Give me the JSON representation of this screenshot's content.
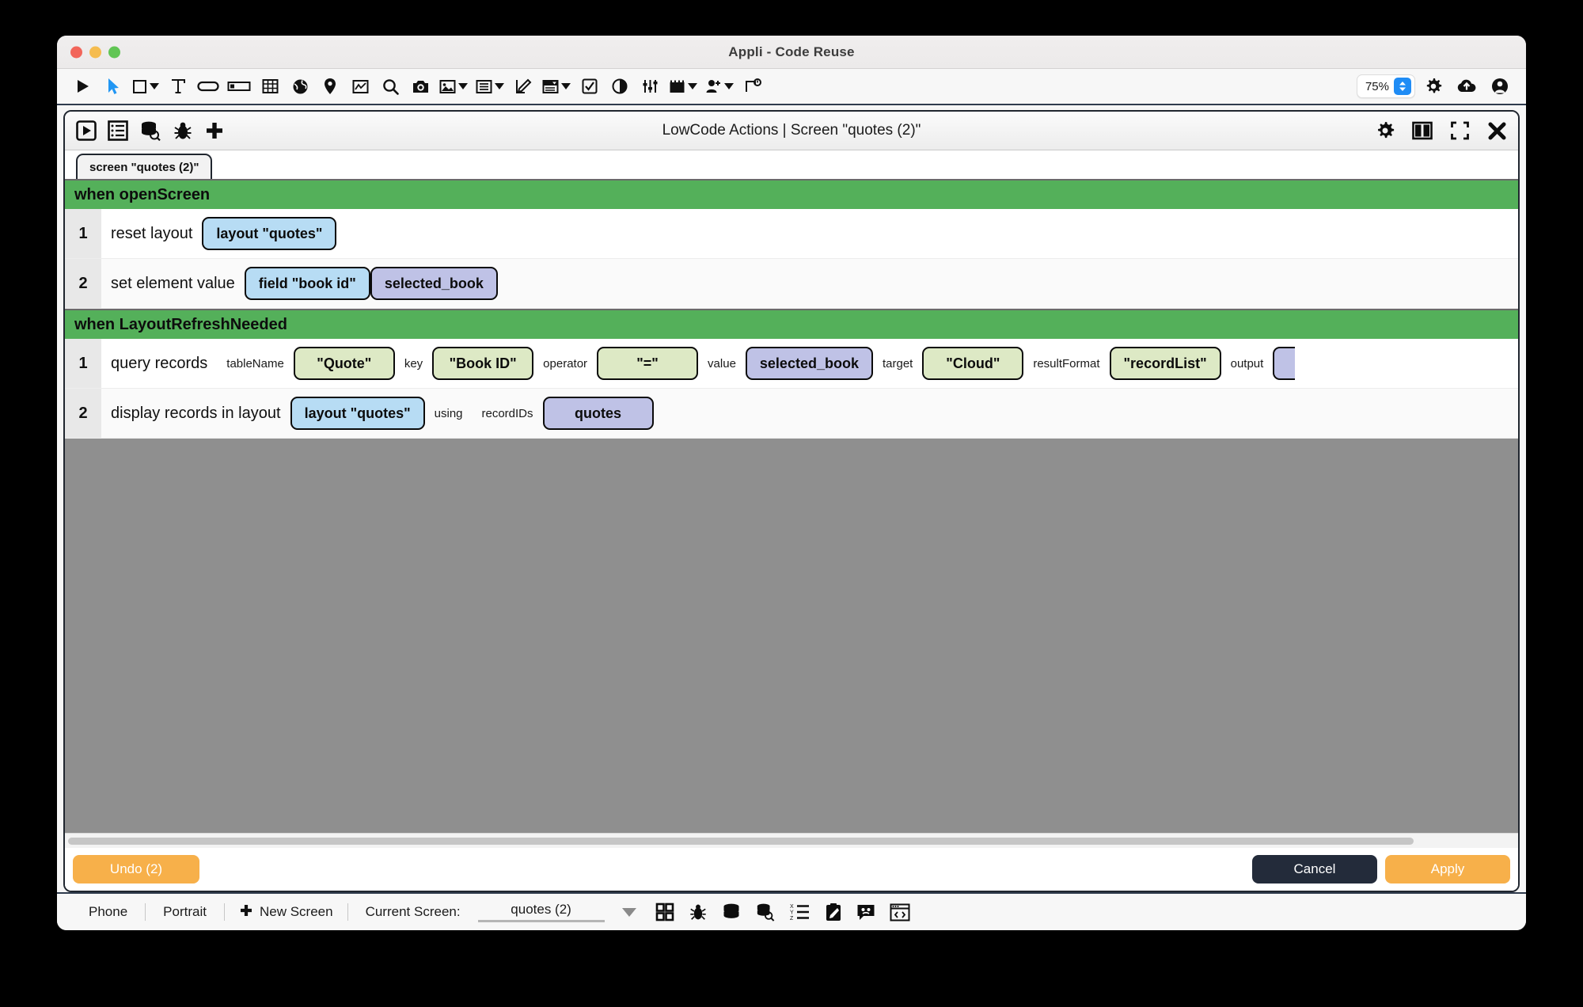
{
  "window": {
    "title": "Appli - Code Reuse",
    "traffic_lights": [
      "close",
      "minimize",
      "zoom"
    ]
  },
  "app_toolbar": {
    "left_icons": [
      {
        "name": "play-icon",
        "glyph": "play"
      },
      {
        "name": "cursor-select-icon",
        "glyph": "cursor"
      },
      {
        "name": "rectangle-shape-icon",
        "glyph": "square",
        "dropdown": true
      },
      {
        "name": "text-tool-icon",
        "glyph": "T"
      },
      {
        "name": "button-icon",
        "glyph": "pill"
      },
      {
        "name": "text-field-icon",
        "glyph": "field"
      },
      {
        "name": "table-icon",
        "glyph": "grid"
      },
      {
        "name": "web-view-icon",
        "glyph": "globe"
      },
      {
        "name": "map-pin-icon",
        "glyph": "pin"
      },
      {
        "name": "chart-icon",
        "glyph": "chart"
      },
      {
        "name": "search-icon",
        "glyph": "magnifier"
      },
      {
        "name": "camera-icon",
        "glyph": "camera"
      },
      {
        "name": "image-icon",
        "glyph": "image",
        "dropdown": true
      },
      {
        "name": "list-icon",
        "glyph": "list",
        "dropdown": true
      },
      {
        "name": "signature-icon",
        "glyph": "edit-square"
      },
      {
        "name": "dropdown-control-icon",
        "glyph": "select",
        "dropdown": true
      },
      {
        "name": "checkbox-icon",
        "glyph": "checkbox"
      },
      {
        "name": "toggle-icon",
        "glyph": "toggle"
      },
      {
        "name": "slider-icon",
        "glyph": "sliders"
      },
      {
        "name": "date-picker-icon",
        "glyph": "calendar",
        "dropdown": true
      },
      {
        "name": "add-user-icon",
        "glyph": "person-plus",
        "dropdown": true
      },
      {
        "name": "push-notification-icon",
        "glyph": "flag"
      }
    ],
    "zoom_value": "75%",
    "right_icons": [
      {
        "name": "settings-gear-icon",
        "glyph": "gear"
      },
      {
        "name": "cloud-upload-icon",
        "glyph": "cloud-up"
      },
      {
        "name": "account-icon",
        "glyph": "person"
      }
    ]
  },
  "lowcode_panel": {
    "title": "LowCode Actions | Screen \"quotes (2)\"",
    "left_icons": [
      {
        "name": "run-actions-icon",
        "glyph": "play-box"
      },
      {
        "name": "actions-list-icon",
        "glyph": "list-box"
      },
      {
        "name": "data-query-icon",
        "glyph": "db-search"
      },
      {
        "name": "debug-icon",
        "glyph": "bug"
      },
      {
        "name": "add-action-icon",
        "glyph": "plus"
      }
    ],
    "right_icons": [
      {
        "name": "panel-settings-icon",
        "glyph": "gear"
      },
      {
        "name": "split-view-icon",
        "glyph": "split"
      },
      {
        "name": "fullscreen-icon",
        "glyph": "expand"
      },
      {
        "name": "close-panel-icon",
        "glyph": "x"
      }
    ],
    "tab_label": "screen \"quotes (2)\"",
    "blocks": [
      {
        "event": "when openScreen",
        "rows": [
          {
            "number": "1",
            "verb": "reset layout",
            "parts": [
              {
                "kind": "chip",
                "style": "blue",
                "text": "layout \"quotes\"",
                "name": "chip-layout-quotes"
              }
            ]
          },
          {
            "number": "2",
            "verb": "set element value",
            "parts": [
              {
                "kind": "chip",
                "style": "blue",
                "text": "field \"book id\"",
                "name": "chip-field-book-id"
              },
              {
                "kind": "chip",
                "style": "purple",
                "text": "selected_book",
                "name": "chip-selected-book"
              }
            ]
          }
        ]
      },
      {
        "event": "when LayoutRefreshNeeded",
        "rows": [
          {
            "number": "1",
            "verb": "query records",
            "parts": [
              {
                "kind": "label",
                "text": "tableName",
                "name": "param-label-tablename"
              },
              {
                "kind": "chip",
                "style": "green",
                "text": "\"Quote\"",
                "name": "chip-table-quote"
              },
              {
                "kind": "label",
                "text": "key",
                "name": "param-label-key"
              },
              {
                "kind": "chip",
                "style": "green",
                "text": "\"Book ID\"",
                "name": "chip-key-book-id"
              },
              {
                "kind": "label",
                "text": "operator",
                "name": "param-label-operator"
              },
              {
                "kind": "chip",
                "style": "green",
                "text": "\"=\"",
                "name": "chip-operator-equals"
              },
              {
                "kind": "label",
                "text": "value",
                "name": "param-label-value"
              },
              {
                "kind": "chip",
                "style": "purple",
                "text": "selected_book",
                "name": "chip-value-selected-book"
              },
              {
                "kind": "label",
                "text": "target",
                "name": "param-label-target"
              },
              {
                "kind": "chip",
                "style": "green",
                "text": "\"Cloud\"",
                "name": "chip-target-cloud"
              },
              {
                "kind": "label",
                "text": "resultFormat",
                "name": "param-label-resultformat"
              },
              {
                "kind": "chip",
                "style": "green",
                "text": "\"recordList\"",
                "name": "chip-resultformat-recordlist"
              },
              {
                "kind": "label",
                "text": "output",
                "name": "param-label-output"
              },
              {
                "kind": "chip-clipped",
                "style": "purple",
                "text": "",
                "name": "chip-output-clipped"
              }
            ]
          },
          {
            "number": "2",
            "verb": "display records in layout",
            "parts": [
              {
                "kind": "chip",
                "style": "blue",
                "text": "layout \"quotes\"",
                "name": "chip-display-layout-quotes"
              },
              {
                "kind": "label",
                "text": "using",
                "name": "param-label-using"
              },
              {
                "kind": "label",
                "text": "recordIDs",
                "name": "param-label-recordids"
              },
              {
                "kind": "chip",
                "style": "purple",
                "text": "quotes",
                "name": "chip-recordids-quotes"
              }
            ]
          }
        ]
      }
    ]
  },
  "action_bar": {
    "undo_label": "Undo (2)",
    "cancel_label": "Cancel",
    "apply_label": "Apply"
  },
  "status_bar": {
    "device": "Phone",
    "orientation": "Portrait",
    "new_screen_label": "New Screen",
    "current_screen_label": "Current Screen:",
    "current_screen_value": "quotes (2)",
    "icons": [
      {
        "name": "screens-grid-icon",
        "glyph": "grid4"
      },
      {
        "name": "debug-bug-icon",
        "glyph": "bug"
      },
      {
        "name": "database-icon",
        "glyph": "db"
      },
      {
        "name": "database-search-icon",
        "glyph": "db-search"
      },
      {
        "name": "variables-list-icon",
        "glyph": "xyz"
      },
      {
        "name": "notes-icon",
        "glyph": "clipboard-pencil"
      },
      {
        "name": "chat-icon",
        "glyph": "speech-face"
      },
      {
        "name": "code-preview-icon",
        "glyph": "code-window"
      }
    ]
  },
  "colors": {
    "accent_green_event": "#54b05a",
    "chip_blue": "#b7dcf4",
    "chip_purple": "#bfc2e6",
    "chip_green": "#dde9c5",
    "button_orange": "#f7b04a",
    "button_dark": "#232b3a",
    "canvas_gray": "#8f8f8f"
  }
}
